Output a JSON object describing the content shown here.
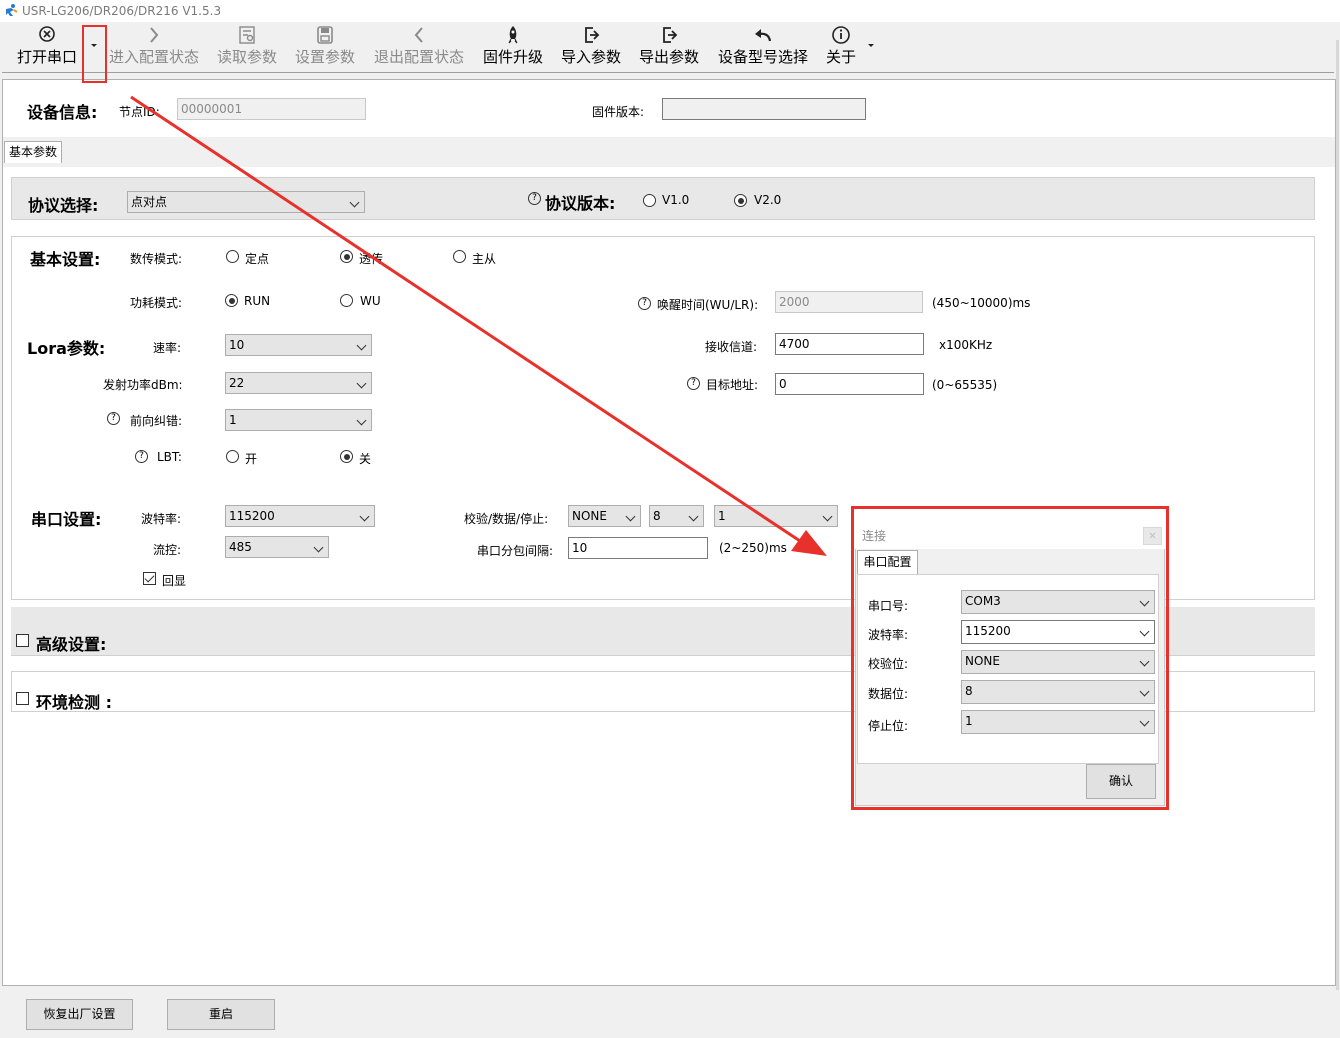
{
  "window": {
    "title": "USR-LG206/DR206/DR216 V1.5.3"
  },
  "toolbar": {
    "items": [
      {
        "label": "打开串口",
        "icon": "connect-icon",
        "enabled": true
      },
      {
        "label": "进入配置状态",
        "icon": "chevron-right-icon",
        "enabled": false
      },
      {
        "label": "读取参数",
        "icon": "read-icon",
        "enabled": false
      },
      {
        "label": "设置参数",
        "icon": "save-icon",
        "enabled": false
      },
      {
        "label": "退出配置状态",
        "icon": "chevron-left-icon",
        "enabled": false
      },
      {
        "label": "固件升级",
        "icon": "rocket-icon",
        "enabled": true
      },
      {
        "label": "导入参数",
        "icon": "import-icon",
        "enabled": true
      },
      {
        "label": "导出参数",
        "icon": "export-icon",
        "enabled": true
      },
      {
        "label": "设备型号选择",
        "icon": "undo-arrow-icon",
        "enabled": true
      },
      {
        "label": "关于",
        "icon": "info-icon",
        "enabled": true
      }
    ]
  },
  "device_info": {
    "heading": "设备信息:",
    "node_id_label": "节点ID:",
    "node_id_value": "00000001",
    "firmware_label": "固件版本:",
    "firmware_value": ""
  },
  "tabs": [
    "基本参数"
  ],
  "protocol": {
    "label": "协议选择:",
    "value": "点对点",
    "version_label": "协议版本:",
    "v1": "V1.0",
    "v2": "V2.0",
    "selected": "V2.0"
  },
  "basic": {
    "heading": "基本设置:",
    "mode_label": "数传模式:",
    "mode_options": [
      "定点",
      "透传",
      "主从"
    ],
    "mode_selected": "透传",
    "power_label": "功耗模式:",
    "power_options": [
      "RUN",
      "WU"
    ],
    "power_selected": "RUN",
    "wake_label": "唤醒时间(WU/LR):",
    "wake_value": "2000",
    "wake_range": "(450~10000)ms"
  },
  "lora": {
    "heading": "Lora参数:",
    "rate_label": "速率:",
    "rate_value": "10",
    "power_label": "发射功率dBm:",
    "power_value": "22",
    "fec_label": "前向纠错:",
    "fec_value": "1",
    "lbt_label": "LBT:",
    "lbt_on": "开",
    "lbt_off": "关",
    "lbt_selected": "关",
    "channel_label": "接收信道:",
    "channel_value": "4700",
    "channel_unit": "x100KHz",
    "target_label": "目标地址:",
    "target_value": "0",
    "target_range": "(0~65535)"
  },
  "serial": {
    "heading": "串口设置:",
    "baud_label": "波特率:",
    "baud_value": "115200",
    "flow_label": "流控:",
    "flow_value": "485",
    "echo_label": "回显",
    "echo_checked": true,
    "parity_label": "校验/数据/停止:",
    "parity_value": "NONE",
    "data_bits_value": "8",
    "stop_bits_value": "1",
    "interval_label": "串口分包间隔:",
    "interval_value": "10",
    "interval_range": "(2~250)ms"
  },
  "advanced": {
    "label": "高级设置:"
  },
  "env": {
    "label": "环境检测 :"
  },
  "footer": {
    "reset_label": "恢复出厂设置",
    "restart_label": "重启"
  },
  "dialog": {
    "title": "连接",
    "tab": "串口配置",
    "port_label": "串口号:",
    "port_value": "COM3",
    "baud_label": "波特率:",
    "baud_value": "115200",
    "parity_label": "校验位:",
    "parity_value": "NONE",
    "data_label": "数据位:",
    "data_value": "8",
    "stop_label": "停止位:",
    "stop_value": "1",
    "ok_label": "确认"
  },
  "colors": {
    "annotation_red": "#e8312a",
    "panel_border": "#d0d0d0"
  }
}
